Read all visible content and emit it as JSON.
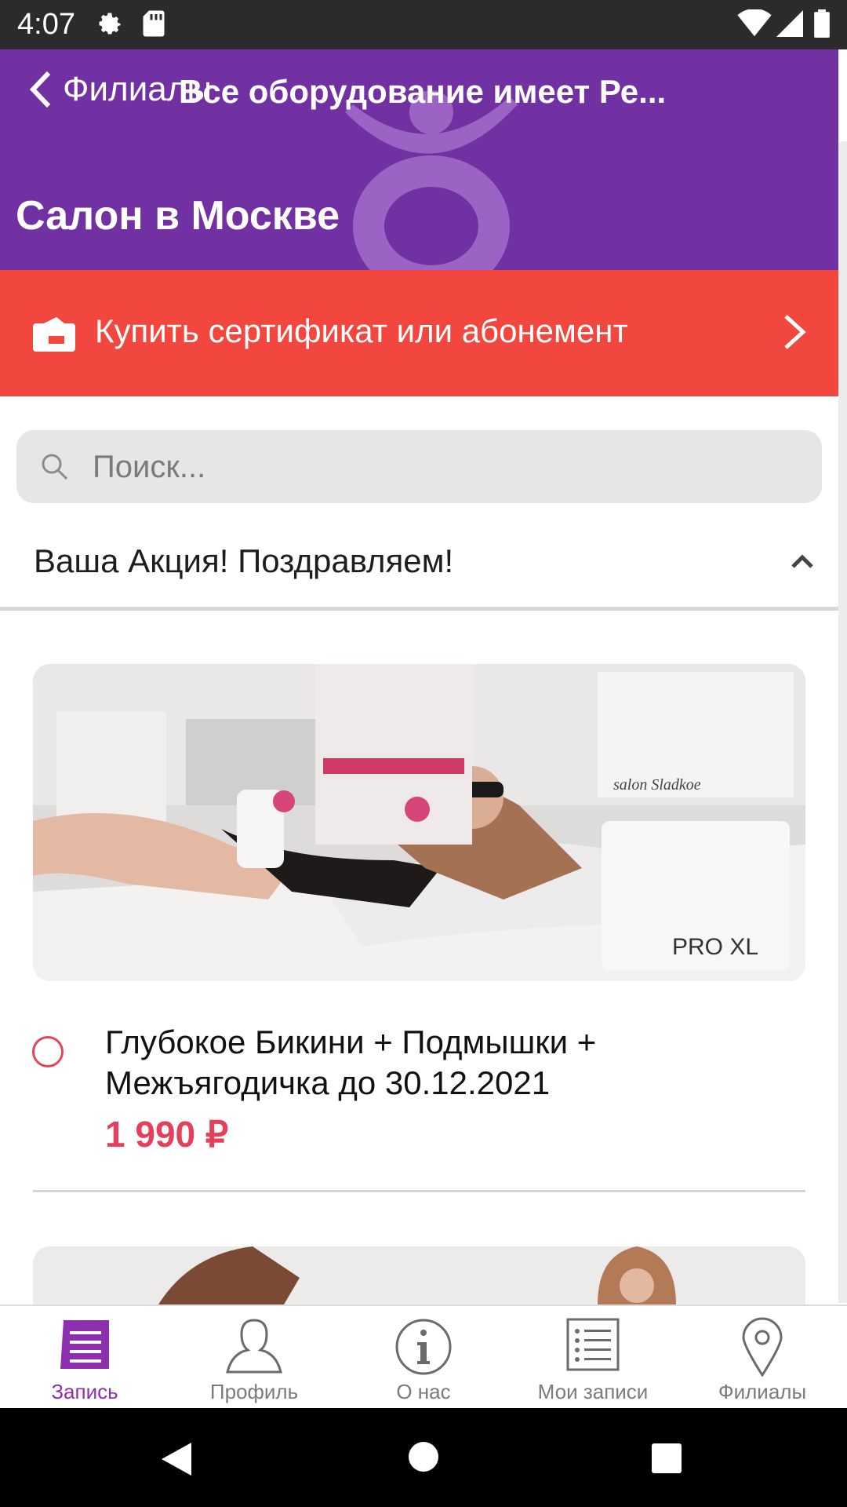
{
  "status_bar": {
    "time": "4:07",
    "icons": [
      "gear-icon",
      "sd-card-icon",
      "wifi-icon",
      "signal-icon",
      "battery-icon"
    ]
  },
  "header": {
    "back_label": "Филиалы",
    "title": "Все оборудование имеет Ре...",
    "salon_name": "Салон в Москве",
    "bg_color": "#7231a2"
  },
  "certificate_banner": {
    "label": "Купить сертификат или абонемент",
    "bg_color": "#f2473f"
  },
  "search": {
    "placeholder": "Поиск..."
  },
  "section": {
    "title": "Ваша Акция! Поздравляем!"
  },
  "promotions": [
    {
      "title": "Глубокое Бикини + Подмышки + Межъягодичка до 30.12.2021",
      "price": "1 990 ₽",
      "image_text": "PRO XL"
    }
  ],
  "tabs": [
    {
      "label": "Запись",
      "icon": "booking-list-icon",
      "active": true
    },
    {
      "label": "Профиль",
      "icon": "profile-icon",
      "active": false
    },
    {
      "label": "О нас",
      "icon": "info-icon",
      "active": false
    },
    {
      "label": "Мои записи",
      "icon": "my-bookings-icon",
      "active": false
    },
    {
      "label": "Филиалы",
      "icon": "location-pin-icon",
      "active": false
    }
  ],
  "colors": {
    "accent": "#8e2fb0",
    "price": "#e63f5c"
  }
}
